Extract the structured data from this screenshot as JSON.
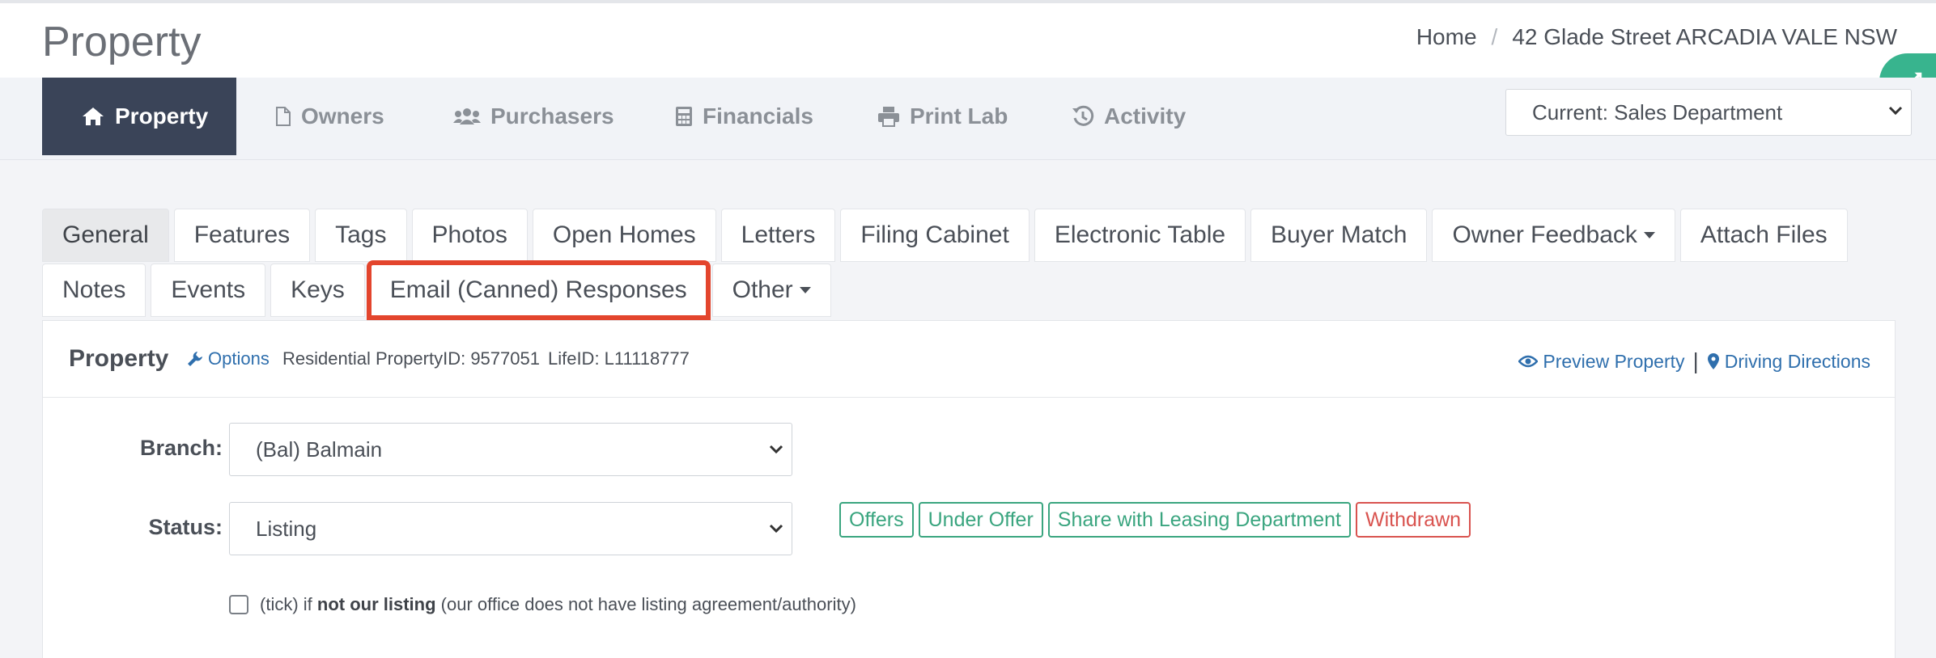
{
  "header": {
    "title": "Property",
    "breadcrumb": [
      "Home",
      "42 Glade Street ARCADIA VALE NSW"
    ]
  },
  "nav": {
    "items": [
      {
        "label": "Property",
        "icon": "home-icon"
      },
      {
        "label": "Owners",
        "icon": "file-icon"
      },
      {
        "label": "Purchasers",
        "icon": "users-icon"
      },
      {
        "label": "Financials",
        "icon": "calculator-icon"
      },
      {
        "label": "Print Lab",
        "icon": "print-icon"
      },
      {
        "label": "Activity",
        "icon": "history-icon"
      }
    ],
    "department": "Current: Sales Department"
  },
  "tabs": {
    "row1": [
      "General",
      "Features",
      "Tags",
      "Photos",
      "Open Homes",
      "Letters",
      "Filing Cabinet",
      "Electronic Table",
      "Buyer Match",
      "Owner Feedback",
      "Attach Files"
    ],
    "row2": [
      "Notes",
      "Events",
      "Keys",
      "Email (Canned) Responses",
      "Other"
    ],
    "active": "General",
    "highlighted": "Email (Canned) Responses"
  },
  "panel": {
    "title": "Property",
    "options_label": "Options",
    "residential_id": "Residential PropertyID: 9577051",
    "life_id": "LifeID: L11118777",
    "preview_label": "Preview Property",
    "directions_label": "Driving Directions"
  },
  "form": {
    "branch_label": "Branch:",
    "branch_value": "(Bal) Balmain",
    "status_label": "Status:",
    "status_value": "Listing",
    "status_tags": [
      "Offers",
      "Under Offer",
      "Share with Leasing Department",
      "Withdrawn"
    ],
    "checkbox_pre": "(tick) if",
    "checkbox_bold": "not our listing",
    "checkbox_post": "(our office does not have listing agreement/authority)"
  },
  "colors": {
    "nav_active_bg": "#3a4458",
    "accent_green": "#3aa57f",
    "danger_red": "#d9534f",
    "link_blue": "#2f6fad",
    "highlight_red": "#e3452d"
  }
}
